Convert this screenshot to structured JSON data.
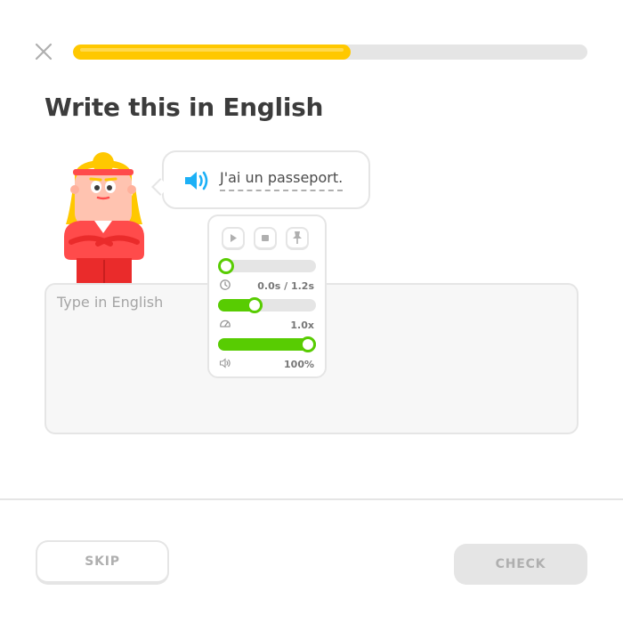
{
  "header": {
    "close_icon": "close-icon",
    "progress": 0.54
  },
  "prompt": {
    "title": "Write this in English"
  },
  "bubble": {
    "speaker_icon": "speaker-icon",
    "sentence": "J'ai un passeport."
  },
  "answer": {
    "placeholder": "Type in English",
    "value": ""
  },
  "audio_controls": {
    "play_icon": "play-icon",
    "stop_icon": "stop-icon",
    "pin_icon": "pin-icon",
    "position": {
      "icon": "clock-icon",
      "label": "0.0s / 1.2s",
      "fraction": 0.0
    },
    "speed": {
      "icon": "speedometer-icon",
      "label": "1.0x",
      "fraction": 0.35
    },
    "volume": {
      "icon": "volume-icon",
      "label": "100%",
      "fraction": 1.0
    }
  },
  "footer": {
    "skip_label": "SKIP",
    "check_label": "CHECK"
  },
  "colors": {
    "progress": "#ffc800",
    "slider": "#58cc02",
    "speaker": "#1cb0f6",
    "character_shirt": "#ff4b4b",
    "character_hair": "#ffc800"
  }
}
